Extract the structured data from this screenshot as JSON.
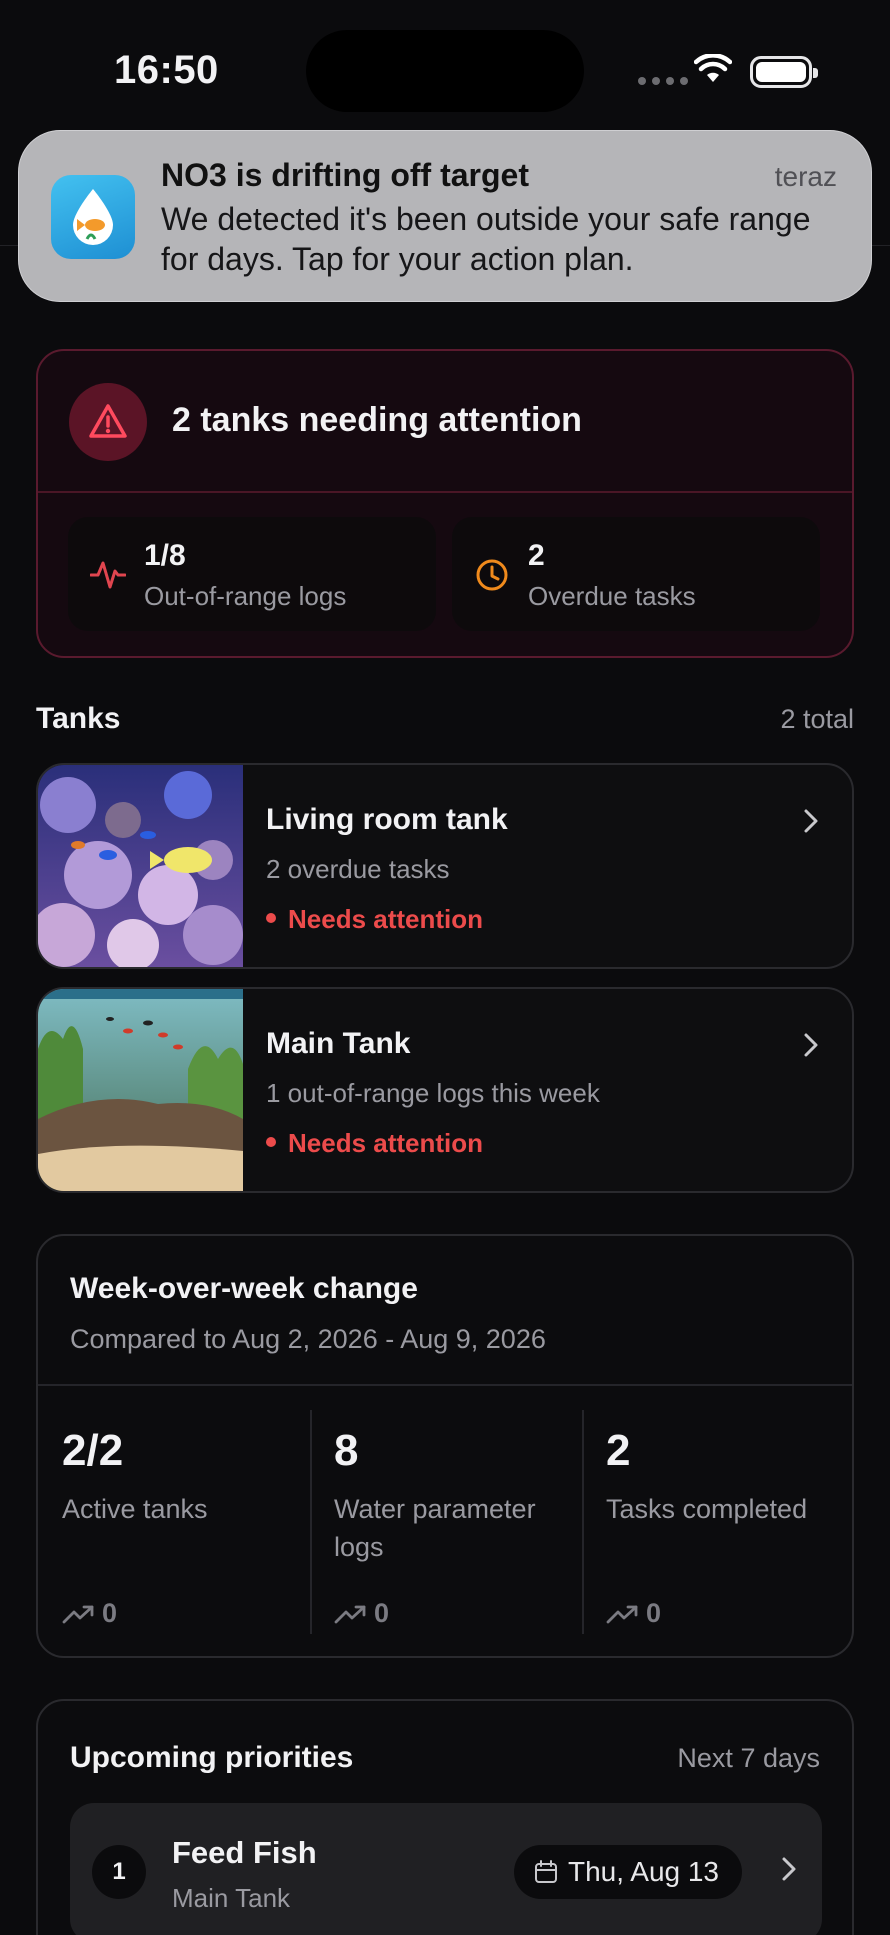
{
  "status_bar": {
    "time": "16:50"
  },
  "notification": {
    "title": "NO3 is drifting off target",
    "when": "teraz",
    "body": "We detected it's been outside your safe range for days. Tap for your action plan."
  },
  "alert": {
    "title": "2 tanks needing attention",
    "stats": [
      {
        "value": "1/8",
        "label": "Out-of-range logs",
        "icon": "pulse-icon",
        "color": "#e0454f"
      },
      {
        "value": "2",
        "label": "Overdue tasks",
        "icon": "clock-icon",
        "color": "#f08a1c"
      }
    ]
  },
  "tanks": {
    "title": "Tanks",
    "count": "2 total",
    "items": [
      {
        "name": "Living room tank",
        "subtitle": "2 overdue tasks",
        "status": "Needs attention"
      },
      {
        "name": "Main Tank",
        "subtitle": "1 out-of-range logs this week",
        "status": "Needs attention"
      }
    ]
  },
  "week_over_week": {
    "title": "Week-over-week change",
    "subtitle": "Compared to Aug 2, 2026 - Aug 9, 2026",
    "metrics": [
      {
        "value": "2/2",
        "label": "Active tanks",
        "trend": "0"
      },
      {
        "value": "8",
        "label": "Water parameter logs",
        "trend": "0"
      },
      {
        "value": "2",
        "label": "Tasks completed",
        "trend": "0"
      }
    ]
  },
  "priorities": {
    "title": "Upcoming priorities",
    "range": "Next 7 days",
    "items": [
      {
        "rank": "1",
        "name": "Feed Fish",
        "tank": "Main Tank",
        "date": "Thu, Aug 13"
      }
    ]
  },
  "colors": {
    "background": "#0b0b0d",
    "alert_red": "#ec4b4b",
    "alert_border": "#5a1a2e"
  }
}
